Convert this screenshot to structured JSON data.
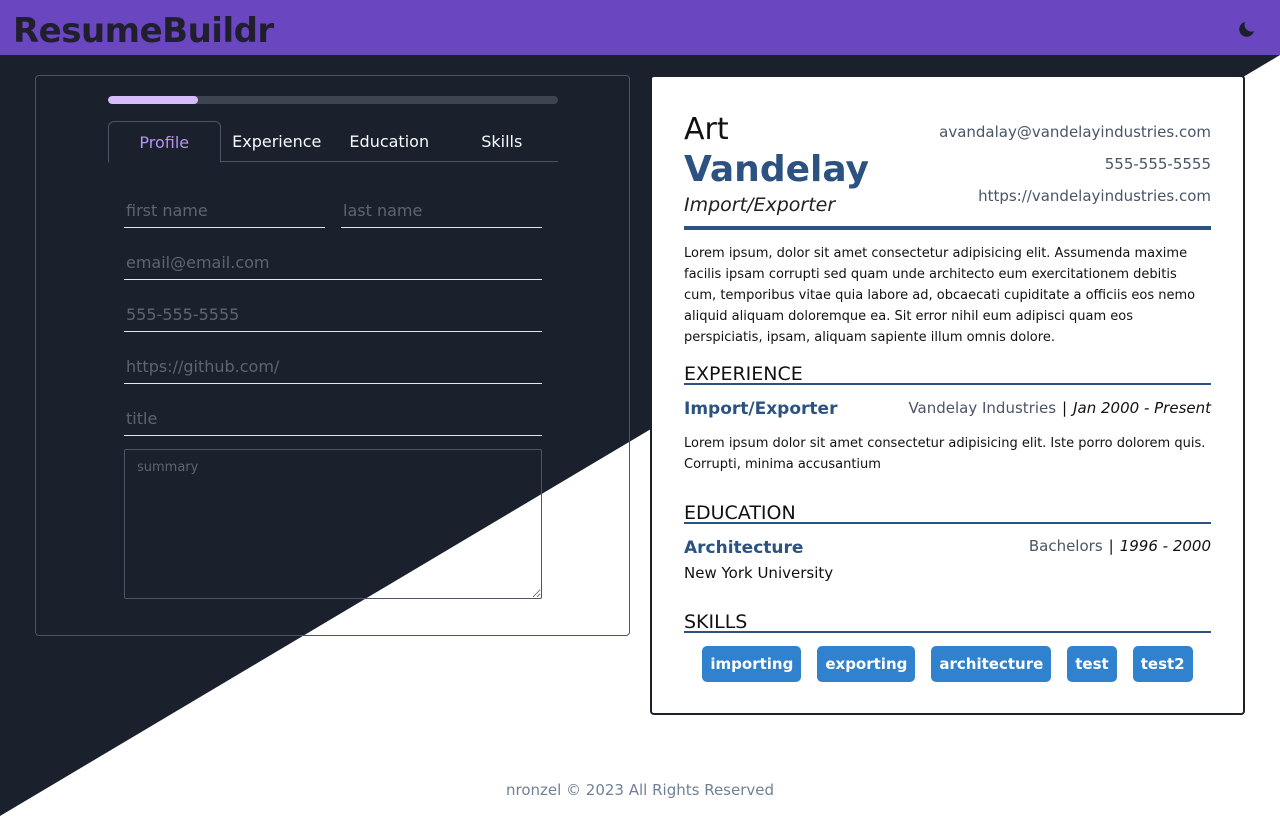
{
  "app": {
    "brand": "ResumeBuildr",
    "theme_icon": "moon-icon"
  },
  "colors": {
    "topbar": "#6b46c1",
    "dark_bg": "#1a202c",
    "accent_purple": "#b794f4",
    "resume_accent": "#2c5282",
    "skill_badge": "#3182ce"
  },
  "form": {
    "progress_fraction": 0.2,
    "tabs": [
      {
        "label": "Profile",
        "active": true
      },
      {
        "label": "Experience",
        "active": false
      },
      {
        "label": "Education",
        "active": false
      },
      {
        "label": "Skills",
        "active": false
      }
    ],
    "fields": {
      "first_name_placeholder": "first name",
      "last_name_placeholder": "last name",
      "email_placeholder": "email@email.com",
      "phone_placeholder": "555-555-5555",
      "url_placeholder": "https://github.com/",
      "title_placeholder": "title",
      "summary_placeholder": "summary"
    }
  },
  "resume": {
    "first_name": "Art",
    "last_name": "Vandelay",
    "title": "Import/Exporter",
    "email": "avandalay@vandelayindustries.com",
    "phone": "555-555-5555",
    "url": "https://vandelayindustries.com",
    "summary": "Lorem ipsum, dolor sit amet consectetur adipisicing elit. Assumenda maxime facilis ipsam corrupti sed quam unde architecto eum exercitationem debitis cum, temporibus vitae quia labore ad, obcaecati cupiditate a officiis eos nemo aliquid aliquam doloremque ea. Sit error nihil eum adipisci quam eos perspiciatis, ipsam, aliquam sapiente illum omnis dolore.",
    "experience": {
      "heading": "EXPERIENCE",
      "role": "Import/Exporter",
      "company": "Vandelay Industries",
      "separator": "|",
      "dates": "Jan 2000 - Present",
      "description": "Lorem ipsum dolor sit amet consectetur adipisicing elit. Iste porro dolorem quis. Corrupti, minima accusantium"
    },
    "education": {
      "heading": "EDUCATION",
      "field": "Architecture",
      "degree": "Bachelors",
      "separator": "|",
      "dates": "1996 - 2000",
      "school": "New York University"
    },
    "skills": {
      "heading": "SKILLS",
      "items": [
        "importing",
        "exporting",
        "architecture",
        "test",
        "test2"
      ]
    }
  },
  "footer": {
    "text": "nronzel © 2023 All Rights Reserved"
  }
}
